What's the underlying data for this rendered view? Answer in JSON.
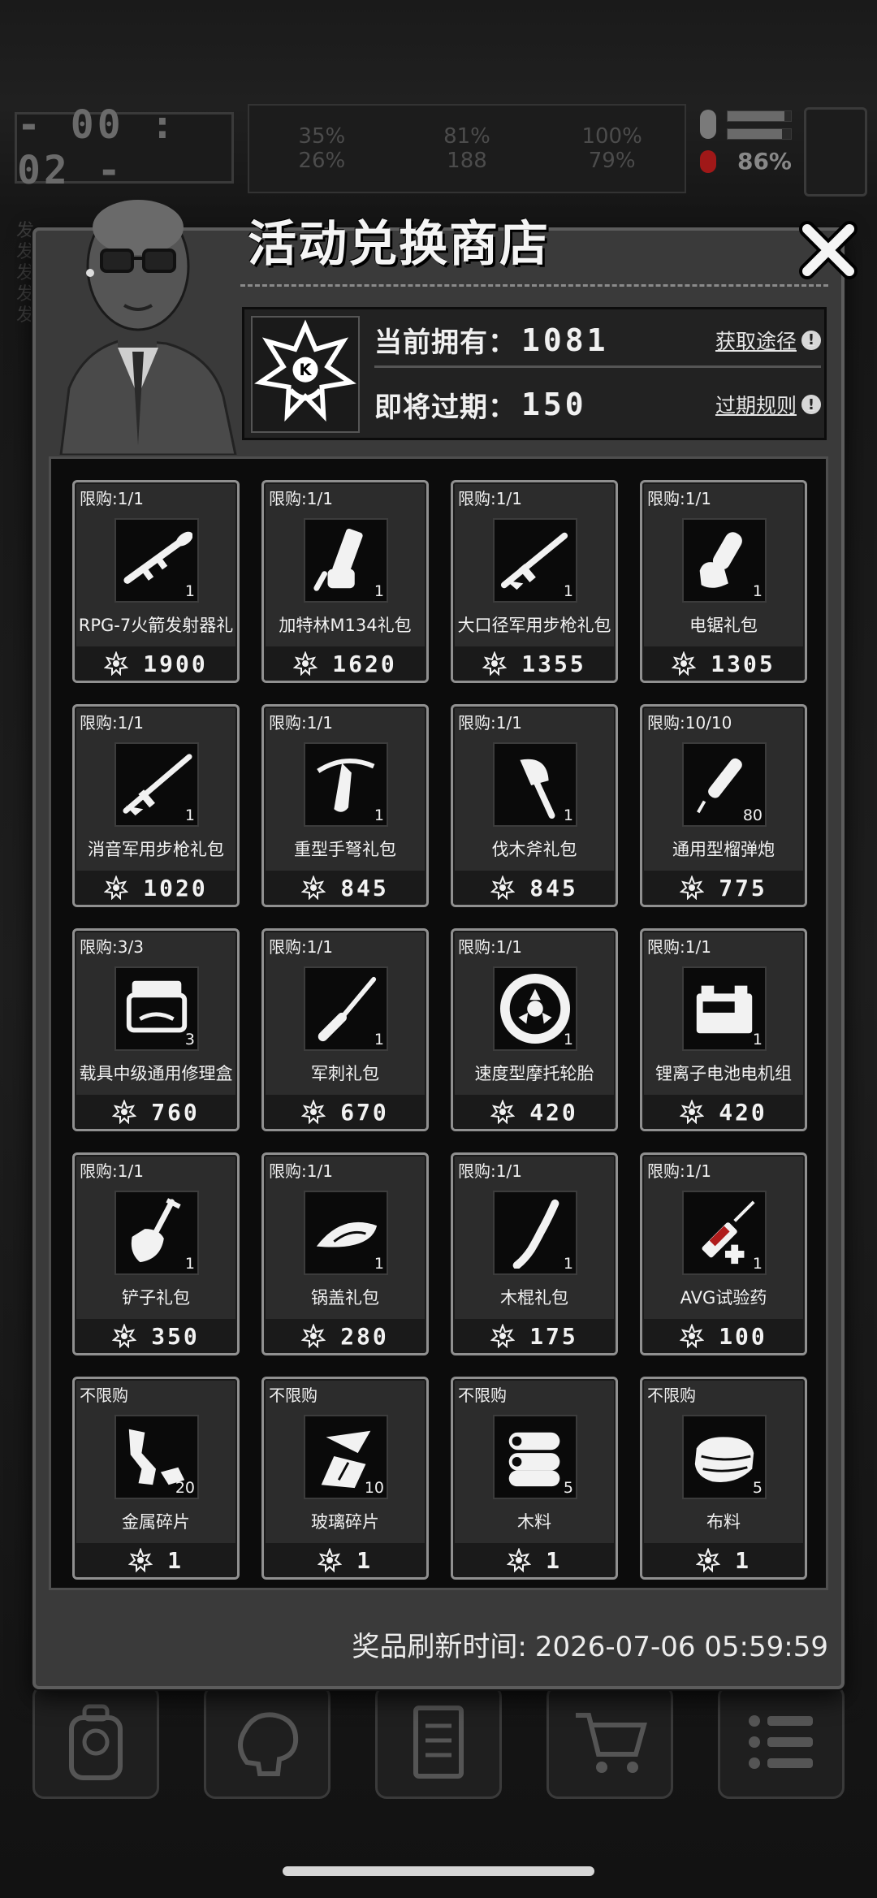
{
  "hud": {
    "timer": "- 00 : 02 -",
    "stats": [
      "35%",
      "81%",
      "100%",
      "26%",
      "188",
      "79%"
    ],
    "energy_percent": "86%",
    "log_lines": [
      "发",
      "发",
      "发",
      "发",
      "发"
    ]
  },
  "shop": {
    "title": "活动兑换商店",
    "owned_label": "当前拥有：",
    "owned_value": "1081",
    "expiring_label": "即将过期：",
    "expiring_value": "150",
    "obtain_link": "获取途径",
    "expire_rule_link": "过期规则",
    "refresh_label": "奖品刷新时间:",
    "refresh_time": "2026-07-06 05:59:59",
    "items": [
      {
        "limit": "限购:1/1",
        "name": "RPG-7火箭发射器礼",
        "qty": "1",
        "price": "1900",
        "icon": "rpg-icon"
      },
      {
        "limit": "限购:1/1",
        "name": "加特林M134礼包",
        "qty": "1",
        "price": "1620",
        "icon": "gatling-icon"
      },
      {
        "limit": "限购:1/1",
        "name": "大口径军用步枪礼包",
        "qty": "1",
        "price": "1355",
        "icon": "rifle-icon"
      },
      {
        "limit": "限购:1/1",
        "name": "电锯礼包",
        "qty": "1",
        "price": "1305",
        "icon": "chainsaw-icon"
      },
      {
        "limit": "限购:1/1",
        "name": "消音军用步枪礼包",
        "qty": "1",
        "price": "1020",
        "icon": "silenced-rifle-icon"
      },
      {
        "limit": "限购:1/1",
        "name": "重型手弩礼包",
        "qty": "1",
        "price": "845",
        "icon": "crossbow-icon"
      },
      {
        "limit": "限购:1/1",
        "name": "伐木斧礼包",
        "qty": "1",
        "price": "845",
        "icon": "axe-icon"
      },
      {
        "limit": "限购:10/10",
        "name": "通用型榴弹炮",
        "qty": "80",
        "price": "775",
        "icon": "grenade-shell-icon"
      },
      {
        "limit": "限购:3/3",
        "name": "载具中级通用修理盒",
        "qty": "3",
        "price": "760",
        "icon": "repair-box-icon"
      },
      {
        "limit": "限购:1/1",
        "name": "军刺礼包",
        "qty": "1",
        "price": "670",
        "icon": "bayonet-icon"
      },
      {
        "limit": "限购:1/1",
        "name": "速度型摩托轮胎",
        "qty": "1",
        "price": "420",
        "icon": "tire-icon"
      },
      {
        "limit": "限购:1/1",
        "name": "锂离子电池电机组",
        "qty": "1",
        "price": "420",
        "icon": "battery-icon"
      },
      {
        "limit": "限购:1/1",
        "name": "铲子礼包",
        "qty": "1",
        "price": "350",
        "icon": "shovel-icon"
      },
      {
        "limit": "限购:1/1",
        "name": "锅盖礼包",
        "qty": "1",
        "price": "280",
        "icon": "pot-lid-icon"
      },
      {
        "limit": "限购:1/1",
        "name": "木棍礼包",
        "qty": "1",
        "price": "175",
        "icon": "wooden-stick-icon"
      },
      {
        "limit": "限购:1/1",
        "name": "AVG试验药",
        "qty": "1",
        "price": "100",
        "icon": "syringe-icon"
      },
      {
        "limit": "不限购",
        "name": "金属碎片",
        "qty": "20",
        "price": "1",
        "icon": "metal-scrap-icon"
      },
      {
        "limit": "不限购",
        "name": "玻璃碎片",
        "qty": "10",
        "price": "1",
        "icon": "glass-shard-icon"
      },
      {
        "limit": "不限购",
        "name": "木料",
        "qty": "5",
        "price": "1",
        "icon": "wood-logs-icon"
      },
      {
        "limit": "不限购",
        "name": "布料",
        "qty": "5",
        "price": "1",
        "icon": "cloth-icon"
      }
    ]
  },
  "nav": {
    "tabs": [
      {
        "icon": "backpack-icon"
      },
      {
        "icon": "brain-icon"
      },
      {
        "icon": "notebook-icon"
      },
      {
        "icon": "cart-icon"
      },
      {
        "icon": "menu-list-icon"
      }
    ]
  },
  "colors": {
    "panel": "#3a3a3a",
    "card": "#2c2c2c",
    "card_border": "#909090",
    "text": "#f2f2f2",
    "syringe_accent": "#b01c1c"
  }
}
